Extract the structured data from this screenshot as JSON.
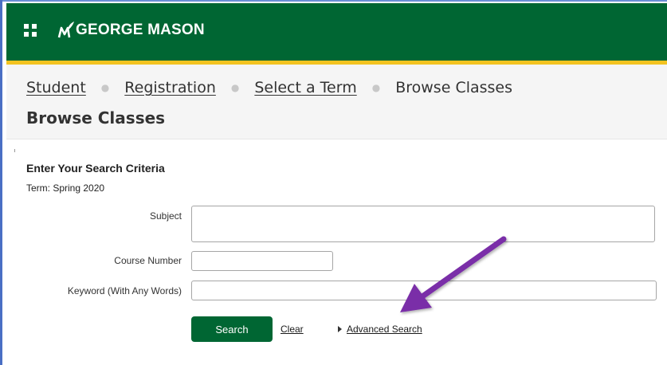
{
  "header": {
    "logo_text": "GEORGE MASON",
    "brand_green": "#006633",
    "accent_gold": "#f2c320",
    "apps_icon": "grid-icon"
  },
  "breadcrumb": {
    "items": [
      "Student",
      "Registration",
      "Select a Term"
    ],
    "current": "Browse Classes"
  },
  "page": {
    "title": "Browse Classes"
  },
  "form": {
    "heading": "Enter Your Search Criteria",
    "term": "Term: Spring 2020",
    "subject_label": "Subject",
    "subject_value": "",
    "course_number_label": "Course Number",
    "course_number_value": "",
    "keyword_label": "Keyword (With Any Words)",
    "keyword_value": "",
    "search_button": "Search",
    "clear_link": "Clear",
    "advanced_search_link": "Advanced Search"
  },
  "annotation": {
    "arrow_color": "#7a2fa8",
    "arrow_icon": "arrow-pointer-icon"
  }
}
